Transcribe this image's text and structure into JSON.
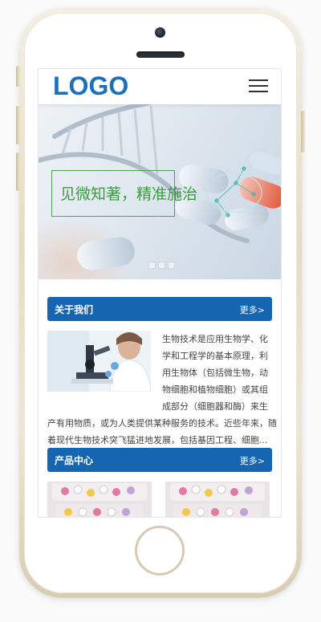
{
  "header": {
    "logo": "LOGO",
    "menu_icon": "hamburger-menu-icon"
  },
  "banner": {
    "slogan": "见微知著，精准施治",
    "slides": 3
  },
  "about": {
    "title": "关于我们",
    "more": "更多>",
    "lines": [
      "生物技术是应用生物学、化",
      "学和工程学的基本原理，利",
      "用生物体（包括微生物，动",
      "物细胞和植物细胞）或其组",
      "成部分（细胞器和酶）来生",
      "产有用物质，或为人类提供某种服务的技术。近些年来，随",
      "着现代生物技术突飞猛进地发展，包括基因工程、细胞..."
    ]
  },
  "products": {
    "title": "产品中心",
    "more": "更多>"
  },
  "colors": {
    "brand": "#1665b1",
    "logo": "#1f6fb8",
    "slogan": "#3d9b42"
  }
}
